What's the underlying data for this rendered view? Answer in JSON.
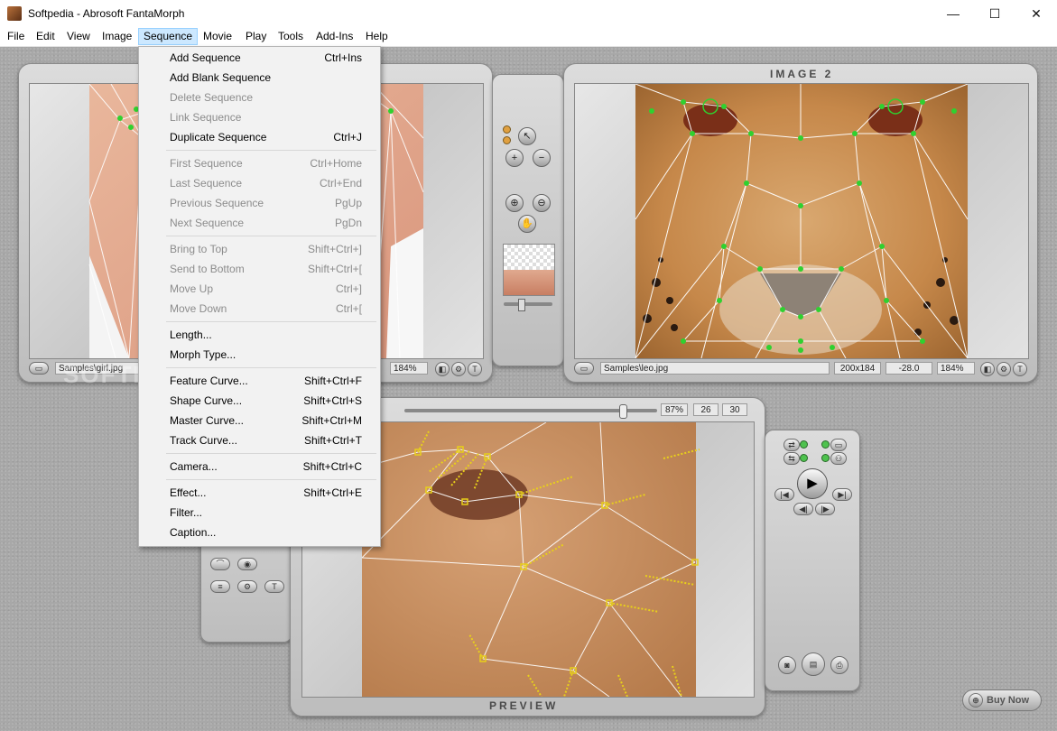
{
  "window": {
    "title": "Softpedia - Abrosoft FantaMorph",
    "minimize": "—",
    "maximize": "☐",
    "close": "✕"
  },
  "menubar": [
    "File",
    "Edit",
    "View",
    "Image",
    "Sequence",
    "Movie",
    "Play",
    "Tools",
    "Add-Ins",
    "Help"
  ],
  "sequence_menu": [
    {
      "label": "Add Sequence",
      "shortcut": "Ctrl+Ins",
      "enabled": true
    },
    {
      "label": "Add Blank Sequence",
      "shortcut": "",
      "enabled": true
    },
    {
      "label": "Delete Sequence",
      "shortcut": "",
      "enabled": false
    },
    {
      "label": "Link Sequence",
      "shortcut": "",
      "enabled": false
    },
    {
      "label": "Duplicate Sequence",
      "shortcut": "Ctrl+J",
      "enabled": true
    },
    {
      "label": "First Sequence",
      "shortcut": "Ctrl+Home",
      "enabled": false
    },
    {
      "label": "Last Sequence",
      "shortcut": "Ctrl+End",
      "enabled": false
    },
    {
      "label": "Previous Sequence",
      "shortcut": "PgUp",
      "enabled": false
    },
    {
      "label": "Next Sequence",
      "shortcut": "PgDn",
      "enabled": false
    },
    {
      "label": "Bring to Top",
      "shortcut": "Shift+Ctrl+]",
      "enabled": false
    },
    {
      "label": "Send to Bottom",
      "shortcut": "Shift+Ctrl+[",
      "enabled": false
    },
    {
      "label": "Move Up",
      "shortcut": "Ctrl+]",
      "enabled": false
    },
    {
      "label": "Move Down",
      "shortcut": "Ctrl+[",
      "enabled": false
    },
    {
      "label": "Length...",
      "shortcut": "",
      "enabled": true
    },
    {
      "label": "Morph Type...",
      "shortcut": "",
      "enabled": true
    },
    {
      "label": "Feature Curve...",
      "shortcut": "Shift+Ctrl+F",
      "enabled": true
    },
    {
      "label": "Shape Curve...",
      "shortcut": "Shift+Ctrl+S",
      "enabled": true
    },
    {
      "label": "Master Curve...",
      "shortcut": "Shift+Ctrl+M",
      "enabled": true
    },
    {
      "label": "Track Curve...",
      "shortcut": "Shift+Ctrl+T",
      "enabled": true
    },
    {
      "label": "Camera...",
      "shortcut": "Shift+Ctrl+C",
      "enabled": true
    },
    {
      "label": "Effect...",
      "shortcut": "Shift+Ctrl+E",
      "enabled": true
    },
    {
      "label": "Filter...",
      "shortcut": "",
      "enabled": true
    },
    {
      "label": "Caption...",
      "shortcut": "",
      "enabled": true
    }
  ],
  "image1": {
    "file": "Samples\\girl.jpg",
    "zoom": "184%"
  },
  "image2": {
    "label": "IMAGE 2",
    "file": "Samples\\leo.jpg",
    "size": "200x184",
    "angle": "-28.0",
    "zoom": "184%"
  },
  "preview": {
    "label": "PREVIEW",
    "percent": "87%",
    "frame": "26",
    "total": "30",
    "progress": 0.87
  },
  "buttons": {
    "buy_now": "Buy Now",
    "t_label": "T"
  },
  "colors": {
    "menu_highlight": "#cce8ff",
    "feature_point_image": "#2fd12f",
    "feature_point_preview": "#e8d01a"
  },
  "watermark": "SOFTPEDIA"
}
